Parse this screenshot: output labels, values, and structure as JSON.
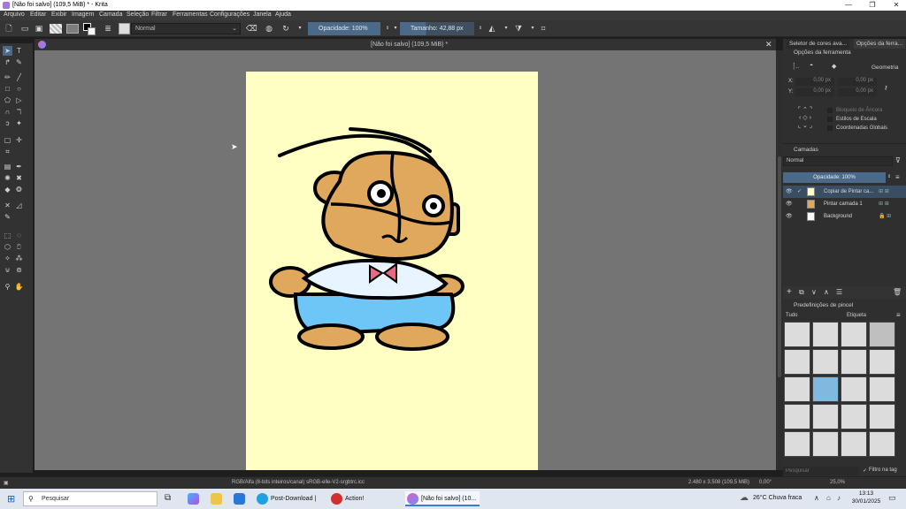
{
  "window": {
    "title": "[Não foi salvo]  (109,5 MiB) * - Krita"
  },
  "window_controls": {
    "minimize": "—",
    "maximize": "❐",
    "close": "✕"
  },
  "menu": [
    "Arquivo",
    "Editar",
    "Exibir",
    "Imagem",
    "Camada",
    "Seleção",
    "Filtrar",
    "Ferramentas",
    "Configurações",
    "Janela",
    "Ajuda"
  ],
  "toolbar": {
    "blend_mode": "Normal",
    "opacity_label": "Opacidade: 100%",
    "opacity_value": 100,
    "size_label": "Tamanho: 42,88 px"
  },
  "document": {
    "tab_title": "[Não foi salvo]  (109,5 MiB) *"
  },
  "right": {
    "tab_color": "Seletor de cores ava...",
    "tab_tool": "Opções da ferra...",
    "tool_options_title": "Opções da ferramenta",
    "geometry": "Geometria",
    "x_label": "X:",
    "y_label": "Y:",
    "fields": [
      "0,00 px",
      "0,00 px",
      "0,00 px",
      "0,00 px"
    ],
    "anchor": "Bloqueio de Âncora",
    "scale": "Estilos de Escala",
    "global": "Coordenadas Globais",
    "layers_title": "Camadas",
    "layers_blend": "Normal",
    "layers_opacity": "Opacidade:  100%",
    "layers": [
      {
        "name": "Copiar de Pintar ca...",
        "selected": true
      },
      {
        "name": "Pintar camada 1",
        "selected": false
      },
      {
        "name": "Background",
        "selected": false
      }
    ],
    "brushes_title": "Predefinições de pincel",
    "brush_filter": "Tudo",
    "brush_tag": "Etiqueta",
    "search_placeholder": "Pesquisar",
    "filter_tag": "Filtro na tag"
  },
  "status": {
    "color_info": "RGB/Alfa (8-bits inteiros/canal)  sRGB-elle-V2-srgbtrc.icc",
    "dims": "2.480 x 3.508 (109,5 MiB)",
    "rotation": "0,00°",
    "zoom": "25,0%"
  },
  "taskbar": {
    "search": "Pesquisar",
    "apps": [
      "Post-Download | Kr...",
      "Action!",
      "[Não foi salvo] (10..."
    ],
    "weather": "26°C  Chuva fraca",
    "time": "13:13",
    "date": "30/01/2025"
  },
  "colors": {
    "accent": "#4b6a8a",
    "paper": "#ffffc4",
    "canvas_bg": "#747474"
  }
}
